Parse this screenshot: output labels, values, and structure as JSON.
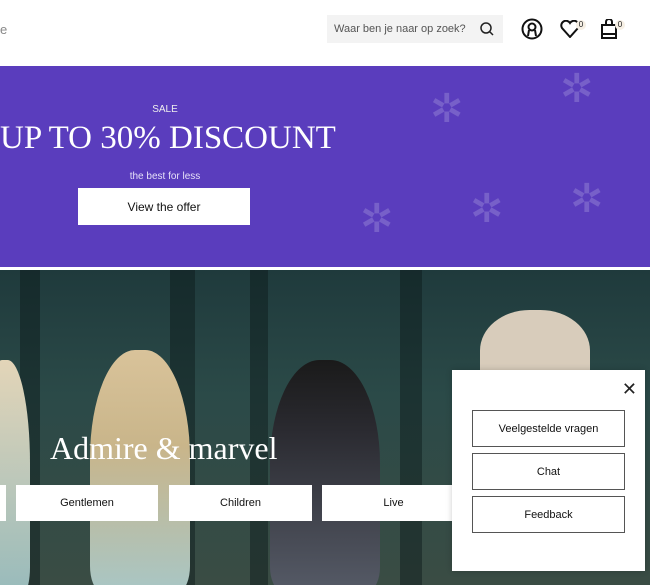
{
  "header": {
    "logo_fragment": "e",
    "search_placeholder": "Waar ben je naar op zoek?",
    "wishlist_count": "0",
    "cart_count": "0"
  },
  "banner": {
    "eyebrow": "SALE",
    "title": "UP TO 30% DISCOUNT",
    "subtitle": "the best for less",
    "cta": "View the offer",
    "bg_color": "#5a3dbd"
  },
  "hero": {
    "title": "Admire & marvel",
    "categories": [
      "Gentlemen",
      "Children",
      "Live"
    ]
  },
  "help_panel": {
    "buttons": [
      "Veelgestelde vragen",
      "Chat",
      "Feedback"
    ]
  }
}
